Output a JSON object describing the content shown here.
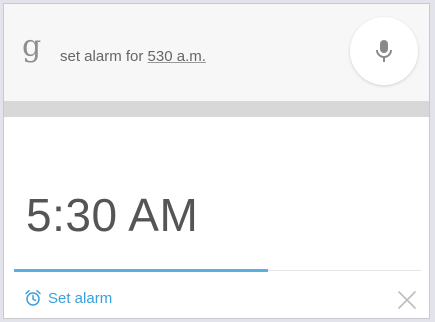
{
  "search": {
    "query_prefix": "set alarm for ",
    "query_underlined": "530 a.m."
  },
  "alarm_card": {
    "time": "5:30 AM",
    "action_label": "Set alarm",
    "progress_fraction": 0.62
  },
  "colors": {
    "accent": "#3aa0dc",
    "progress": "#5aaee0",
    "text_primary": "#555555"
  },
  "icons": {
    "logo": "google-g-icon",
    "mic": "microphone-icon",
    "alarm": "alarm-clock-icon",
    "close": "close-icon"
  }
}
